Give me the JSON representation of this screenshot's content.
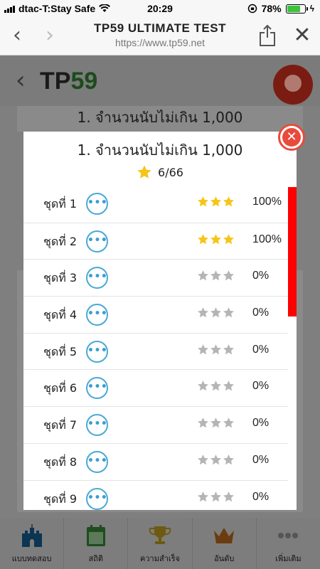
{
  "status_bar": {
    "carrier": "dtac-T:Stay Safe",
    "time": "20:29",
    "battery": "78%",
    "battery_level": 0.78
  },
  "browser": {
    "title": "TP59 ULTIMATE TEST",
    "url": "https://www.tp59.net",
    "back_icon": "chevron-left-icon",
    "forward_icon": "chevron-right-icon",
    "share_icon": "share-icon",
    "close_icon": "close-icon"
  },
  "app": {
    "logo_main": "TP",
    "logo_accent": "59",
    "bg_heading": "1. จำนวนนับไม่เกิน 1,000"
  },
  "modal": {
    "title": "1. จำนวนนับไม่เกิน 1,000",
    "score": "6/66",
    "sets": [
      {
        "label": "ชุดที่ 1",
        "stars": 3,
        "percent": "100%"
      },
      {
        "label": "ชุดที่ 2",
        "stars": 3,
        "percent": "100%"
      },
      {
        "label": "ชุดที่ 3",
        "stars": 0,
        "percent": "0%"
      },
      {
        "label": "ชุดที่ 4",
        "stars": 0,
        "percent": "0%"
      },
      {
        "label": "ชุดที่ 5",
        "stars": 0,
        "percent": "0%"
      },
      {
        "label": "ชุดที่ 6",
        "stars": 0,
        "percent": "0%"
      },
      {
        "label": "ชุดที่ 7",
        "stars": 0,
        "percent": "0%"
      },
      {
        "label": "ชุดที่ 8",
        "stars": 0,
        "percent": "0%"
      },
      {
        "label": "ชุดที่ 9",
        "stars": 0,
        "percent": "0%"
      }
    ],
    "more_label": "•••",
    "star_on_color": "#f5c518",
    "star_off_color": "#b5b5b5",
    "scrollbar_color": "#ff0000",
    "close_color": "#e84b3c"
  },
  "tabbar": {
    "items": [
      {
        "label": "แบบทดสอบ",
        "icon": "castle-icon"
      },
      {
        "label": "สถิติ",
        "icon": "calendar-icon"
      },
      {
        "label": "ความสำเร็จ",
        "icon": "trophy-icon"
      },
      {
        "label": "อันดับ",
        "icon": "crown-icon"
      },
      {
        "label": "เพิ่มเติม",
        "icon": "more-icon"
      }
    ]
  }
}
